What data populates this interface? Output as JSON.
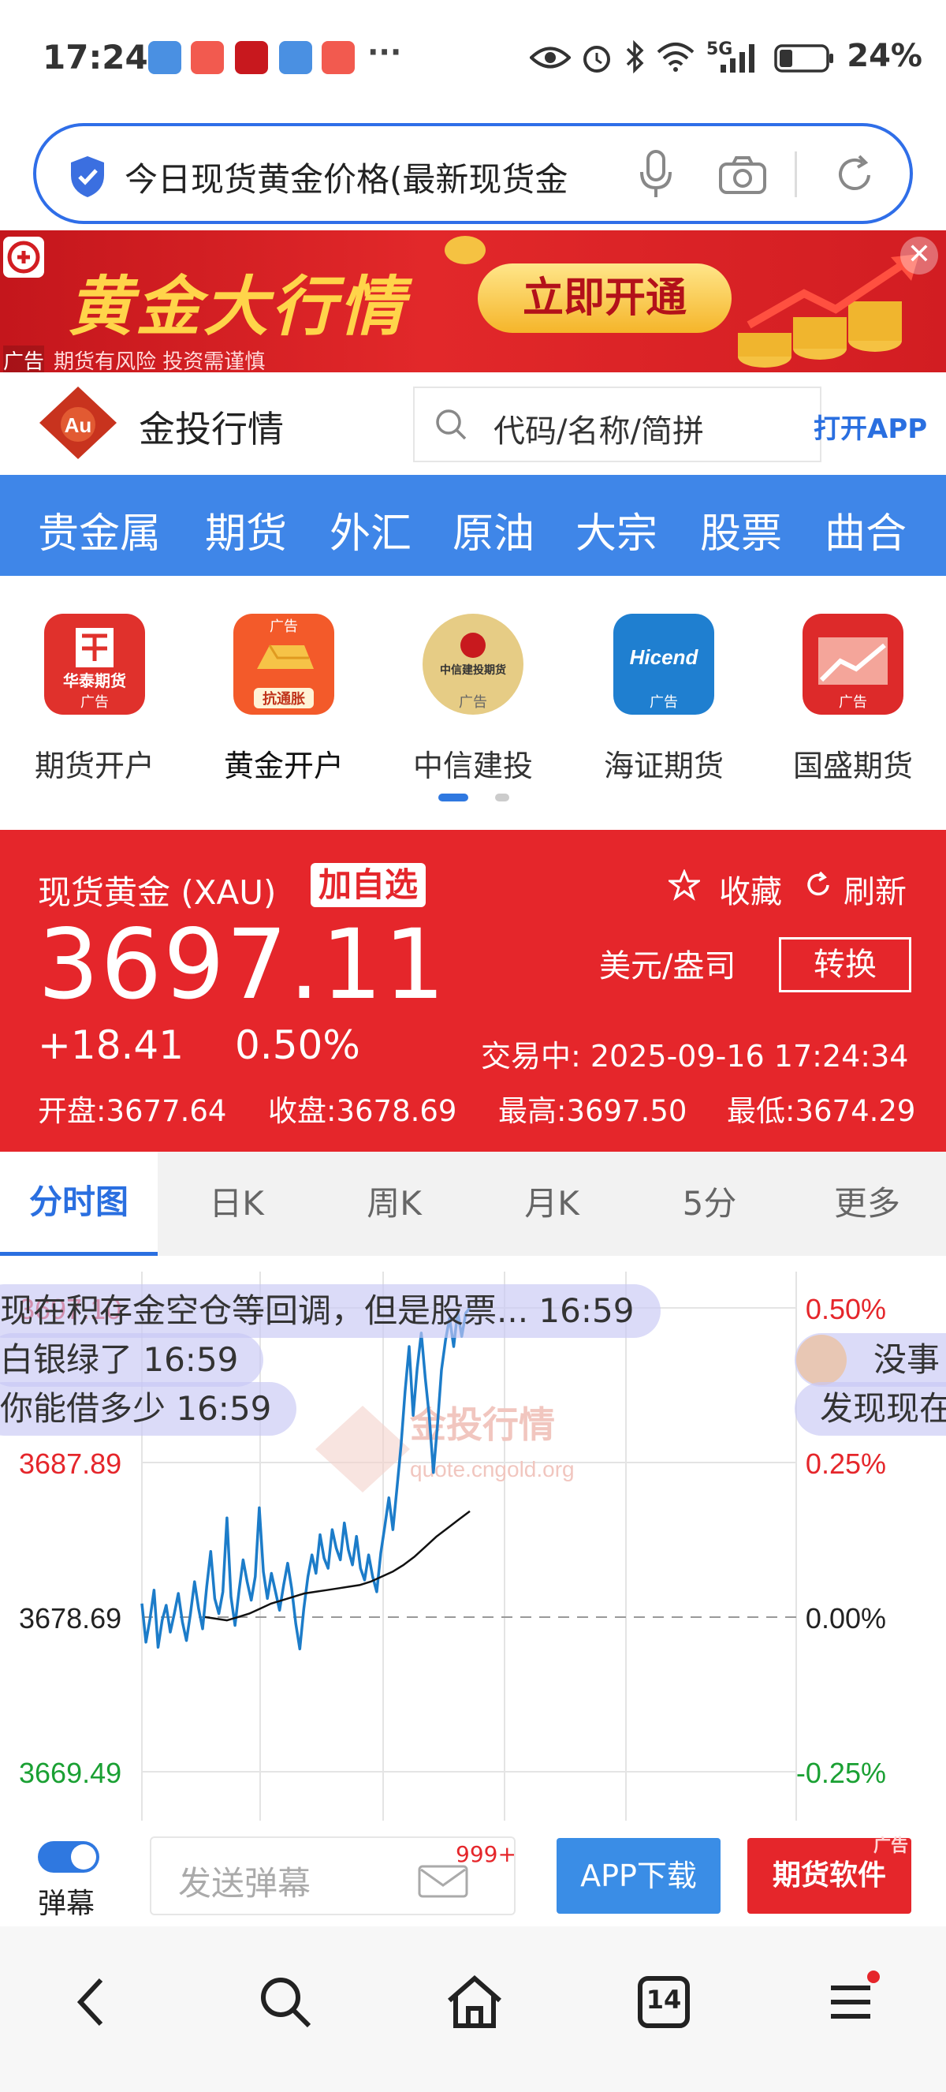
{
  "status_bar": {
    "time": "17:24",
    "more": "···",
    "battery": "24%",
    "network": "5G",
    "icons": [
      "eye-icon",
      "alarm-icon",
      "bluetooth-icon",
      "wifi-icon",
      "signal-icon",
      "battery-icon"
    ]
  },
  "browser": {
    "query": "今日现货黄金价格(最新现货金",
    "icons": [
      "shield-icon",
      "mic-icon",
      "camera-icon",
      "reload-icon"
    ]
  },
  "ad_banner": {
    "title": "黄金大行情",
    "button": "立即开通",
    "ad_tag": "广告",
    "risk": "期货有风险 投资需谨慎",
    "close": "✕"
  },
  "site_header": {
    "name": "金投行情",
    "logo_text": "Au",
    "search_placeholder": "代码/名称/简拼",
    "open_app": "打开APP"
  },
  "nav": {
    "tabs": [
      "贵金属",
      "期货",
      "外汇",
      "原油",
      "大宗",
      "股票",
      "曲合"
    ]
  },
  "quick_links": [
    {
      "label": "期货开户",
      "icon_text": "华泰期货",
      "ad": "广告",
      "color": "#e0312c"
    },
    {
      "label": "黄金开户",
      "icon_text": "抗通胀",
      "ad": "广告",
      "color": "#f35a2a"
    },
    {
      "label": "中信建投",
      "icon_text": "中信建投期货",
      "ad": "广告",
      "color": "#d9b45a"
    },
    {
      "label": "海证期货",
      "icon_text": "Hicend",
      "ad": "广告",
      "color": "#1f7fd0"
    },
    {
      "label": "国盛期货",
      "icon_text": "",
      "ad": "广告",
      "color": "#dd2a2a"
    }
  ],
  "quote": {
    "name": "现货黄金 (XAU)",
    "add_watch": "加自选",
    "favorite": "收藏",
    "refresh": "刷新",
    "price": "3697.11",
    "unit": "美元/盎司",
    "convert": "转换",
    "change": "+18.41",
    "change_pct": "0.50%",
    "trade_status": "交易中: 2025-09-16 17:24:34",
    "open": "开盘:3677.64",
    "prev_close": "收盘:3678.69",
    "high": "最高:3697.50",
    "low": "最低:3674.29",
    "bg_color": "#e5262b"
  },
  "chart_tabs": [
    "分时图",
    "日K",
    "周K",
    "月K",
    "5分",
    "更多"
  ],
  "chart_data": {
    "type": "line",
    "y_left_labels": [
      "3697.10",
      "3687.89",
      "3678.69",
      "3669.49"
    ],
    "y_right_labels": [
      "0.50%",
      "0.25%",
      "0.00%",
      "-0.25%"
    ],
    "ylim": [
      3669.49,
      3697.1
    ],
    "baseline": 3678.69,
    "watermark": "金投行情",
    "watermark_url": "quote.cngold.org",
    "series": [
      {
        "color": "#1c7cc9",
        "values": [
          3679.5,
          3677.2,
          3678.6,
          3680.3,
          3676.9,
          3678.5,
          3679.4,
          3677.8,
          3678.9,
          3680.1,
          3678.4,
          3677.3,
          3678.9,
          3680.8,
          3679.2,
          3678.0,
          3680.5,
          3682.6,
          3679.8,
          3678.9,
          3680.2,
          3684.6,
          3679.9,
          3678.2,
          3680.3,
          3682.1,
          3680.8,
          3679.7,
          3681.1,
          3685.2,
          3681.4,
          3679.8,
          3681.3,
          3680.2,
          3679.1,
          3680.6,
          3681.9,
          3680.4,
          3678.3,
          3676.8,
          3679.2,
          3681.1,
          3682.4,
          3681.3,
          3683.6,
          3682.2,
          3681.6,
          3683.9,
          3682.8,
          3682.1,
          3684.3,
          3682.7,
          3681.8,
          3683.5,
          3681.6,
          3680.9,
          3682.4,
          3681.1,
          3680.2,
          3682.5,
          3684.1,
          3685.8,
          3683.9,
          3686.4,
          3688.9,
          3692.1,
          3694.8,
          3690.7,
          3693.5,
          3695.6,
          3692.9,
          3690.6,
          3687.3,
          3690.1,
          3693.4,
          3695.2,
          3696.5,
          3694.8,
          3696.9,
          3695.4,
          3696.8,
          3697.1
        ]
      },
      {
        "color": "#111111",
        "values": [
          3678.7,
          3678.6,
          3678.5,
          3678.7,
          3678.9,
          3679.2,
          3679.5,
          3679.7,
          3679.9,
          3680.1,
          3680.2,
          3680.3,
          3680.4,
          3680.5,
          3680.6,
          3680.8,
          3681.1,
          3681.4,
          3681.8,
          3682.3,
          3682.9,
          3683.5,
          3684.0,
          3684.5,
          3685.0
        ]
      }
    ]
  },
  "danmaku": [
    "现在积存金空仓等回调，但是股票... 16:59",
    "白银绿了 16:59",
    "你能借多少 16:59",
    "没事",
    "发现现在"
  ],
  "input_bar": {
    "toggle_label": "弹幕",
    "placeholder": "发送弹幕",
    "count": "999+",
    "app_download": "APP下载",
    "software": "期货软件",
    "ad_tag": "广告"
  },
  "bottom_nav": {
    "tab_count": "14",
    "icons": [
      "back-icon",
      "search-icon",
      "home-icon",
      "tabs-icon",
      "menu-icon"
    ]
  }
}
